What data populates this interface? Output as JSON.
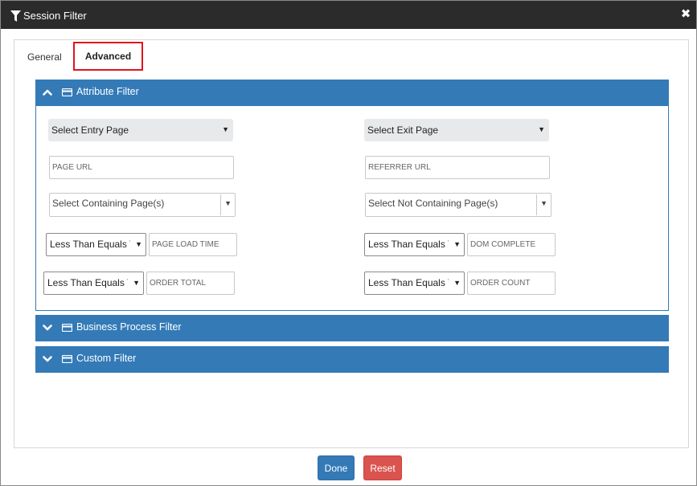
{
  "window": {
    "title": "Session Filter",
    "close_glyph": "✖"
  },
  "tabs": [
    {
      "label": "General",
      "active": false
    },
    {
      "label": "Advanced",
      "active": true
    }
  ],
  "panels": [
    {
      "title": "Attribute Filter",
      "expanded": true
    },
    {
      "title": "Business Process Filter",
      "expanded": false
    },
    {
      "title": "Custom Filter",
      "expanded": false
    }
  ],
  "attribute_filter": {
    "entry_page": "Select Entry Page",
    "exit_page": "Select Exit Page",
    "page_url_placeholder": "PAGE URL",
    "referrer_url_placeholder": "REFERRER URL",
    "containing_pages": "Select Containing Page(s)",
    "not_containing_pages": "Select Not Containing Page(s)",
    "operator_label": "Less Than Equals To",
    "page_load_time_placeholder": "PAGE LOAD TIME",
    "dom_complete_placeholder": "DOM COMPLETE",
    "order_total_placeholder": "ORDER TOTAL",
    "order_count_placeholder": "ORDER COUNT",
    "caret": "▼"
  },
  "footer": {
    "done_label": "Done",
    "reset_label": "Reset"
  },
  "colors": {
    "titlebar": "#2b2b2b",
    "panel_header": "#337ab7",
    "done_button": "#337ab7",
    "reset_button": "#d9534f",
    "active_tab_outline": "#e0141e"
  },
  "icons": {
    "title": "filter-icon",
    "panel": "card-icon",
    "expanded": "chevron-up-icon",
    "collapsed": "chevron-down-icon",
    "close": "close-icon"
  }
}
